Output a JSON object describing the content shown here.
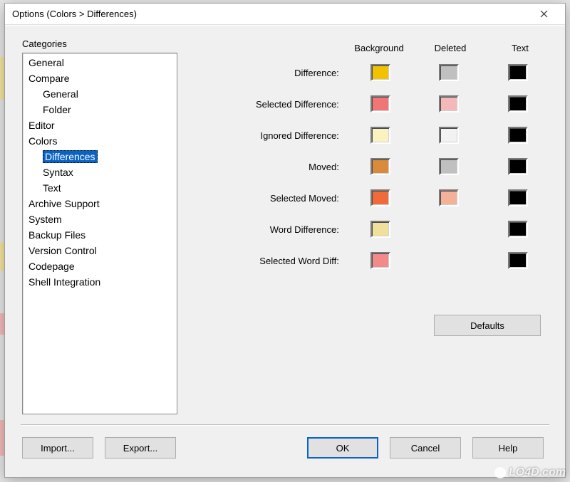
{
  "window": {
    "title": "Options (Colors > Differences)"
  },
  "sidebar": {
    "label": "Categories",
    "items": [
      {
        "label": "General",
        "indent": 0,
        "selected": false
      },
      {
        "label": "Compare",
        "indent": 0,
        "selected": false
      },
      {
        "label": "General",
        "indent": 1,
        "selected": false
      },
      {
        "label": "Folder",
        "indent": 1,
        "selected": false
      },
      {
        "label": "Editor",
        "indent": 0,
        "selected": false
      },
      {
        "label": "Colors",
        "indent": 0,
        "selected": false
      },
      {
        "label": "Differences",
        "indent": 1,
        "selected": true
      },
      {
        "label": "Syntax",
        "indent": 1,
        "selected": false
      },
      {
        "label": "Text",
        "indent": 1,
        "selected": false
      },
      {
        "label": "Archive Support",
        "indent": 0,
        "selected": false
      },
      {
        "label": "System",
        "indent": 0,
        "selected": false
      },
      {
        "label": "Backup Files",
        "indent": 0,
        "selected": false
      },
      {
        "label": "Version Control",
        "indent": 0,
        "selected": false
      },
      {
        "label": "Codepage",
        "indent": 0,
        "selected": false
      },
      {
        "label": "Shell Integration",
        "indent": 0,
        "selected": false
      }
    ]
  },
  "columns": {
    "background": "Background",
    "deleted": "Deleted",
    "text": "Text"
  },
  "rows": [
    {
      "label": "Difference:",
      "bg": "#f2c200",
      "del": "#c0c0c0",
      "txt": "#000000"
    },
    {
      "label": "Selected Difference:",
      "bg": "#f07575",
      "del": "#f5b8b8",
      "txt": "#000000"
    },
    {
      "label": "Ignored Difference:",
      "bg": "#faf3c0",
      "del": "#f2f2f2",
      "txt": "#000000"
    },
    {
      "label": "Moved:",
      "bg": "#d98a3a",
      "del": "#c0c0c0",
      "txt": "#000000"
    },
    {
      "label": "Selected Moved:",
      "bg": "#f06a3a",
      "del": "#f5b098",
      "txt": "#000000"
    },
    {
      "label": "Word Difference:",
      "bg": "#f0e09a",
      "del": null,
      "txt": "#000000"
    },
    {
      "label": "Selected Word Diff:",
      "bg": "#f28a8a",
      "del": null,
      "txt": "#000000"
    }
  ],
  "buttons": {
    "defaults": "Defaults",
    "import": "Import...",
    "export": "Export...",
    "ok": "OK",
    "cancel": "Cancel",
    "help": "Help"
  },
  "watermark": "LO4D.com"
}
